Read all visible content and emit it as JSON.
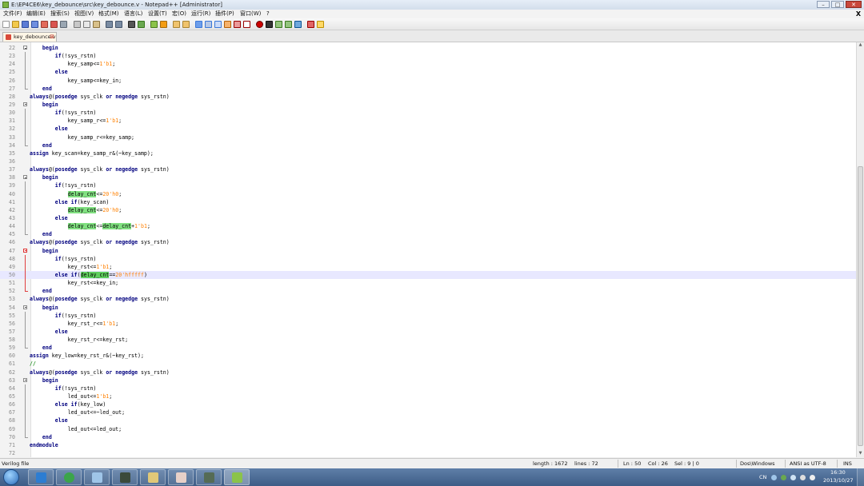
{
  "window": {
    "title": "E:\\EP4CE6\\key_debounce\\src\\key_debounce.v - Notepad++ [Administrator]",
    "btn_min": "–",
    "btn_max": "□",
    "btn_close": "✕"
  },
  "menu": {
    "items": [
      "文件(F)",
      "编辑(E)",
      "搜索(S)",
      "视图(V)",
      "格式(M)",
      "语言(L)",
      "设置(T)",
      "宏(O)",
      "运行(R)",
      "插件(P)",
      "窗口(W)",
      "?"
    ],
    "doc_close": "X"
  },
  "tab": {
    "label": "key_debounce.v",
    "close": "⊠"
  },
  "editor": {
    "current_line": 50,
    "lines": [
      {
        "n": "22",
        "fold": "box",
        "html": "    <span class='kw'>begin</span>"
      },
      {
        "n": "23",
        "fold": "line",
        "html": "        <span class='kw'>if</span>(!sys_rstn)"
      },
      {
        "n": "24",
        "fold": "line",
        "html": "            key_samp&lt;=<span class='num-lit'>1'b1</span>;"
      },
      {
        "n": "25",
        "fold": "line",
        "html": "        <span class='kw'>else</span>"
      },
      {
        "n": "26",
        "fold": "line",
        "html": "            key_samp&lt;=key_in;"
      },
      {
        "n": "27",
        "fold": "end",
        "html": "    <span class='kw'>end</span>"
      },
      {
        "n": "28",
        "fold": "",
        "html": "<span class='kw'>always</span>@(<span class='kw'>posedge</span> sys_clk <span class='kw'>or</span> <span class='kw'>negedge</span> sys_rstn)"
      },
      {
        "n": "29",
        "fold": "box",
        "html": "    <span class='kw'>begin</span>"
      },
      {
        "n": "30",
        "fold": "line",
        "html": "        <span class='kw'>if</span>(!sys_rstn)"
      },
      {
        "n": "31",
        "fold": "line",
        "html": "            key_samp_r&lt;=<span class='num-lit'>1'b1</span>;"
      },
      {
        "n": "32",
        "fold": "line",
        "html": "        <span class='kw'>else</span>"
      },
      {
        "n": "33",
        "fold": "line",
        "html": "            key_samp_r&lt;=key_samp;"
      },
      {
        "n": "34",
        "fold": "end",
        "html": "    <span class='kw'>end</span>"
      },
      {
        "n": "35",
        "fold": "",
        "html": "<span class='kw'>assign</span> key_scan=key_samp_r&amp;(~key_samp);"
      },
      {
        "n": "36",
        "fold": "",
        "html": ""
      },
      {
        "n": "37",
        "fold": "",
        "html": "<span class='kw'>always</span>@(<span class='kw'>posedge</span> sys_clk <span class='kw'>or</span> <span class='kw'>negedge</span> sys_rstn)"
      },
      {
        "n": "38",
        "fold": "box",
        "html": "    <span class='kw'>begin</span>"
      },
      {
        "n": "39",
        "fold": "line",
        "html": "        <span class='kw'>if</span>(!sys_rstn)"
      },
      {
        "n": "40",
        "fold": "line",
        "html": "            <span class='hl'>delay_cnt</span>&lt;=<span class='num-lit'>20'h0</span>;"
      },
      {
        "n": "41",
        "fold": "line",
        "html": "        <span class='kw'>else</span> <span class='kw'>if</span>(key_scan)"
      },
      {
        "n": "42",
        "fold": "line",
        "html": "            <span class='hl'>delay_cnt</span>&lt;=<span class='num-lit'>20'h0</span>;"
      },
      {
        "n": "43",
        "fold": "line",
        "html": "        <span class='kw'>else</span>"
      },
      {
        "n": "44",
        "fold": "line",
        "html": "            <span class='hl'>delay_cnt</span>&lt;=<span class='hl'>delay_cnt</span>+<span class='num-lit'>1'b1</span>;"
      },
      {
        "n": "45",
        "fold": "end",
        "html": "    <span class='kw'>end</span>"
      },
      {
        "n": "46",
        "fold": "",
        "html": "<span class='kw'>always</span>@(<span class='kw'>posedge</span> sys_clk <span class='kw'>or</span> <span class='kw'>negedge</span> sys_rstn)"
      },
      {
        "n": "47",
        "fold": "boxred",
        "html": "    <span class='kw'>begin</span>"
      },
      {
        "n": "48",
        "fold": "linered",
        "html": "        <span class='kw'>if</span>(!sys_rstn)"
      },
      {
        "n": "49",
        "fold": "linered",
        "html": "            key_rst&lt;=<span class='num-lit'>1'b1</span>;"
      },
      {
        "n": "50",
        "fold": "linered",
        "html": "        <span class='kw'>else</span> <span class='kw'>if</span>(<span class='hl2'>delay_cnt</span>==<span class='num-lit'>20'hfffff</span>)"
      },
      {
        "n": "51",
        "fold": "linered",
        "html": "            key_rst&lt;=key_in;"
      },
      {
        "n": "52",
        "fold": "endred",
        "html": "    <span class='kw'>end</span>"
      },
      {
        "n": "53",
        "fold": "",
        "html": "<span class='kw'>always</span>@(<span class='kw'>posedge</span> sys_clk <span class='kw'>or</span> <span class='kw'>negedge</span> sys_rstn)"
      },
      {
        "n": "54",
        "fold": "box",
        "html": "    <span class='kw'>begin</span>"
      },
      {
        "n": "55",
        "fold": "line",
        "html": "        <span class='kw'>if</span>(!sys_rstn)"
      },
      {
        "n": "56",
        "fold": "line",
        "html": "            key_rst_r&lt;=<span class='num-lit'>1'b1</span>;"
      },
      {
        "n": "57",
        "fold": "line",
        "html": "        <span class='kw'>else</span>"
      },
      {
        "n": "58",
        "fold": "line",
        "html": "            key_rst_r&lt;=key_rst;"
      },
      {
        "n": "59",
        "fold": "end",
        "html": "    <span class='kw'>end</span>"
      },
      {
        "n": "60",
        "fold": "",
        "html": "<span class='kw'>assign</span> key_low=key_rst_r&amp;(~key_rst);"
      },
      {
        "n": "61",
        "fold": "",
        "html": "<span class='cm'>//</span>"
      },
      {
        "n": "62",
        "fold": "",
        "html": "<span class='kw'>always</span>@(<span class='kw'>posedge</span> sys_clk <span class='kw'>or</span> <span class='kw'>negedge</span> sys_rstn)"
      },
      {
        "n": "63",
        "fold": "box",
        "html": "    <span class='kw'>begin</span>"
      },
      {
        "n": "64",
        "fold": "line",
        "html": "        <span class='kw'>if</span>(!sys_rstn)"
      },
      {
        "n": "65",
        "fold": "line",
        "html": "            led_out&lt;=<span class='num-lit'>1'b1</span>;"
      },
      {
        "n": "66",
        "fold": "line",
        "html": "        <span class='kw'>else</span> <span class='kw'>if</span>(key_low)"
      },
      {
        "n": "67",
        "fold": "line",
        "html": "            led_out&lt;=~led_out;"
      },
      {
        "n": "68",
        "fold": "line",
        "html": "        <span class='kw'>else</span>"
      },
      {
        "n": "69",
        "fold": "line",
        "html": "            led_out&lt;=led_out;"
      },
      {
        "n": "70",
        "fold": "end",
        "html": "    <span class='kw'>end</span>"
      },
      {
        "n": "71",
        "fold": "",
        "html": "<span class='kw'>endmodule</span>"
      },
      {
        "n": "72",
        "fold": "",
        "html": ""
      }
    ]
  },
  "status": {
    "file_type": "Verilog file",
    "length": "length : 1672",
    "lines": "lines : 72",
    "ln": "Ln : 50",
    "col": "Col : 26",
    "sel": "Sel : 9 | 0",
    "eol": "Dos\\Windows",
    "encoding": "ANSI as UTF-8",
    "mode": "INS"
  },
  "taskbar": {
    "tray_lang": "CN",
    "time": "16:30",
    "date": "2013/10/27"
  },
  "colors": {
    "keyword": "#00007f",
    "number": "#ff8000",
    "highlight": "#80e080",
    "current_line": "#e8e8ff",
    "taskbar": "#4a6a94"
  }
}
